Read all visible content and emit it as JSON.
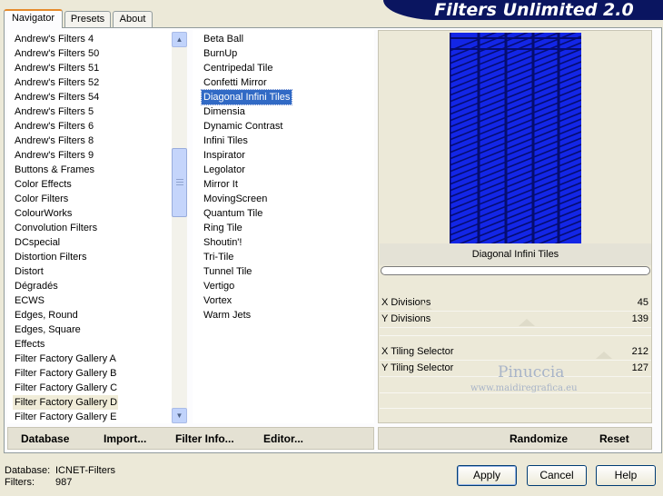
{
  "app": {
    "title": "Filters Unlimited 2.0"
  },
  "tabs": [
    {
      "label": "Navigator",
      "active": true
    },
    {
      "label": "Presets",
      "active": false
    },
    {
      "label": "About",
      "active": false
    }
  ],
  "categories": {
    "items": [
      "Andrew's Filters 4",
      "Andrew's Filters 50",
      "Andrew's Filters 51",
      "Andrew's Filters 52",
      "Andrew's Filters 54",
      "Andrew's Filters 5",
      "Andrew's Filters 6",
      "Andrew's Filters 8",
      "Andrew's Filters 9",
      "Buttons & Frames",
      "Color Effects",
      "Color Filters",
      "ColourWorks",
      "Convolution Filters",
      "DCspecial",
      "Distortion Filters",
      "Distort",
      "Dégradés",
      "ECWS",
      "Edges, Round",
      "Edges, Square",
      "Effects",
      "Filter Factory Gallery A",
      "Filter Factory Gallery B",
      "Filter Factory Gallery C",
      "Filter Factory Gallery D",
      "Filter Factory Gallery E"
    ],
    "selected": "Filter Factory Gallery D"
  },
  "filters": {
    "items": [
      "Beta Ball",
      "BurnUp",
      "Centripedal Tile",
      "Confetti Mirror",
      "Diagonal Infini Tiles",
      "Dimensia",
      "Dynamic Contrast",
      "Infini Tiles",
      "Inspirator",
      "Legolator",
      "Mirror It",
      "MovingScreen",
      "Quantum Tile",
      "Ring Tile",
      "Shoutin'!",
      "Tri-Tile",
      "Tunnel Tile",
      "Vertigo",
      "Vortex",
      "Warm Jets"
    ],
    "selected": "Diagonal Infini Tiles"
  },
  "preview": {
    "caption": "Diagonal Infini Tiles",
    "colors": {
      "base": "#0a1bc8",
      "stripe": "#06118a"
    }
  },
  "params": [
    {
      "name": "X Divisions",
      "value": "45"
    },
    {
      "name": "Y Divisions",
      "value": "139"
    },
    {
      "name": "X Tiling Selector",
      "value": "212"
    },
    {
      "name": "Y Tiling Selector",
      "value": "127"
    }
  ],
  "toolbar": {
    "database": "Database",
    "import": "Import...",
    "filter_info": "Filter Info...",
    "editor": "Editor...",
    "randomize": "Randomize",
    "reset": "Reset"
  },
  "status": {
    "database_label": "Database:",
    "database_value": "ICNET-Filters",
    "filters_label": "Filters:",
    "filters_value": "987"
  },
  "buttons": {
    "apply": "Apply",
    "cancel": "Cancel",
    "help": "Help"
  },
  "watermark": {
    "name": "Pinuccia",
    "url": "www.maidiregrafica.eu"
  }
}
